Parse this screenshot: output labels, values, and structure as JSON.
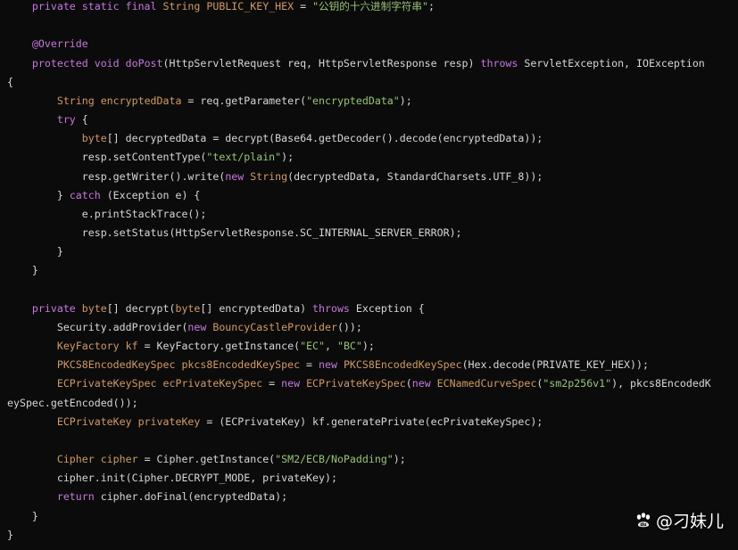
{
  "colors": {
    "background": "#0b0b0b",
    "keyword": "#c678dd",
    "type": "#d19a66",
    "string": "#98c379",
    "plain": "#d7d7d7"
  },
  "code_lines": [
    [
      {
        "t": "kw",
        "v": "    private static final "
      },
      {
        "t": "ty",
        "v": "String "
      },
      {
        "t": "co",
        "v": "PUBLIC_KEY_HEX"
      },
      {
        "t": "tx",
        "v": " = "
      },
      {
        "t": "st",
        "v": "\"公钥的十六进制字符串\""
      },
      {
        "t": "tx",
        "v": ";"
      }
    ],
    [],
    [
      {
        "t": "an",
        "v": "    @Override"
      }
    ],
    [
      {
        "t": "kw",
        "v": "    protected void "
      },
      {
        "t": "fn",
        "v": "doPost"
      },
      {
        "t": "tx",
        "v": "(HttpServletRequest req, HttpServletResponse resp) "
      },
      {
        "t": "kw",
        "v": "throws"
      },
      {
        "t": "tx",
        "v": " ServletException, IOException"
      }
    ],
    [
      {
        "t": "tx",
        "v": "{"
      }
    ],
    [
      {
        "t": "ty",
        "v": "        String "
      },
      {
        "t": "co",
        "v": "encryptedData"
      },
      {
        "t": "tx",
        "v": " = req.getParameter("
      },
      {
        "t": "st",
        "v": "\"encryptedData\""
      },
      {
        "t": "tx",
        "v": ");"
      }
    ],
    [
      {
        "t": "kw",
        "v": "        try"
      },
      {
        "t": "tx",
        "v": " {"
      }
    ],
    [
      {
        "t": "ty",
        "v": "            byte"
      },
      {
        "t": "tx",
        "v": "[] decryptedData = decrypt(Base64.getDecoder().decode(encryptedData));"
      }
    ],
    [
      {
        "t": "tx",
        "v": "            resp.setContentType("
      },
      {
        "t": "st",
        "v": "\"text/plain\""
      },
      {
        "t": "tx",
        "v": ");"
      }
    ],
    [
      {
        "t": "tx",
        "v": "            resp.getWriter().write("
      },
      {
        "t": "kw",
        "v": "new "
      },
      {
        "t": "ty",
        "v": "String"
      },
      {
        "t": "tx",
        "v": "(decryptedData, StandardCharsets.UTF_8));"
      }
    ],
    [
      {
        "t": "tx",
        "v": "        } "
      },
      {
        "t": "kw",
        "v": "catch"
      },
      {
        "t": "tx",
        "v": " (Exception e) {"
      }
    ],
    [
      {
        "t": "tx",
        "v": "            e.printStackTrace();"
      }
    ],
    [
      {
        "t": "tx",
        "v": "            resp.setStatus(HttpServletResponse.SC_INTERNAL_SERVER_ERROR);"
      }
    ],
    [
      {
        "t": "tx",
        "v": "        }"
      }
    ],
    [
      {
        "t": "tx",
        "v": "    }"
      }
    ],
    [],
    [
      {
        "t": "kw",
        "v": "    private "
      },
      {
        "t": "ty",
        "v": "byte"
      },
      {
        "t": "tx",
        "v": "[] decrypt("
      },
      {
        "t": "ty",
        "v": "byte"
      },
      {
        "t": "tx",
        "v": "[] encryptedData) "
      },
      {
        "t": "kw",
        "v": "throws"
      },
      {
        "t": "tx",
        "v": " Exception {"
      }
    ],
    [
      {
        "t": "tx",
        "v": "        Security.addProvider("
      },
      {
        "t": "kw",
        "v": "new "
      },
      {
        "t": "ty",
        "v": "BouncyCastleProvider"
      },
      {
        "t": "tx",
        "v": "());"
      }
    ],
    [
      {
        "t": "ty",
        "v": "        KeyFactory kf"
      },
      {
        "t": "tx",
        "v": " = KeyFactory.getInstance("
      },
      {
        "t": "st",
        "v": "\"EC\""
      },
      {
        "t": "tx",
        "v": ", "
      },
      {
        "t": "st",
        "v": "\"BC\""
      },
      {
        "t": "tx",
        "v": ");"
      }
    ],
    [
      {
        "t": "ty",
        "v": "        PKCS8EncodedKeySpec pkcs8EncodedKeySpec"
      },
      {
        "t": "tx",
        "v": " = "
      },
      {
        "t": "kw",
        "v": "new "
      },
      {
        "t": "ty",
        "v": "PKCS8EncodedKeySpec"
      },
      {
        "t": "tx",
        "v": "(Hex.decode(PRIVATE_KEY_HEX));"
      }
    ],
    [
      {
        "t": "ty",
        "v": "        ECPrivateKeySpec ecPrivateKeySpec"
      },
      {
        "t": "tx",
        "v": " = "
      },
      {
        "t": "kw",
        "v": "new "
      },
      {
        "t": "ty",
        "v": "ECPrivateKeySpec"
      },
      {
        "t": "tx",
        "v": "("
      },
      {
        "t": "kw",
        "v": "new "
      },
      {
        "t": "ty",
        "v": "ECNamedCurveSpec"
      },
      {
        "t": "tx",
        "v": "("
      },
      {
        "t": "st",
        "v": "\"sm2p256v1\""
      },
      {
        "t": "tx",
        "v": "), pkcs8EncodedK"
      }
    ],
    [
      {
        "t": "tx",
        "v": "eySpec.getEncoded());"
      }
    ],
    [
      {
        "t": "ty",
        "v": "        ECPrivateKey privateKey"
      },
      {
        "t": "tx",
        "v": " = (ECPrivateKey) kf.generatePrivate(ecPrivateKeySpec);"
      }
    ],
    [],
    [
      {
        "t": "ty",
        "v": "        Cipher cipher"
      },
      {
        "t": "tx",
        "v": " = Cipher.getInstance("
      },
      {
        "t": "st",
        "v": "\"SM2/ECB/NoPadding\""
      },
      {
        "t": "tx",
        "v": ");"
      }
    ],
    [
      {
        "t": "tx",
        "v": "        cipher.init(Cipher.DECRYPT_MODE, privateKey);"
      }
    ],
    [
      {
        "t": "kw",
        "v": "        return"
      },
      {
        "t": "tx",
        "v": " cipher.doFinal(encryptedData);"
      }
    ],
    [
      {
        "t": "tx",
        "v": "    }"
      }
    ],
    [
      {
        "t": "tx",
        "v": "}"
      }
    ]
  ],
  "watermark": {
    "icon": "paw-icon",
    "text": "@刁妹儿"
  }
}
